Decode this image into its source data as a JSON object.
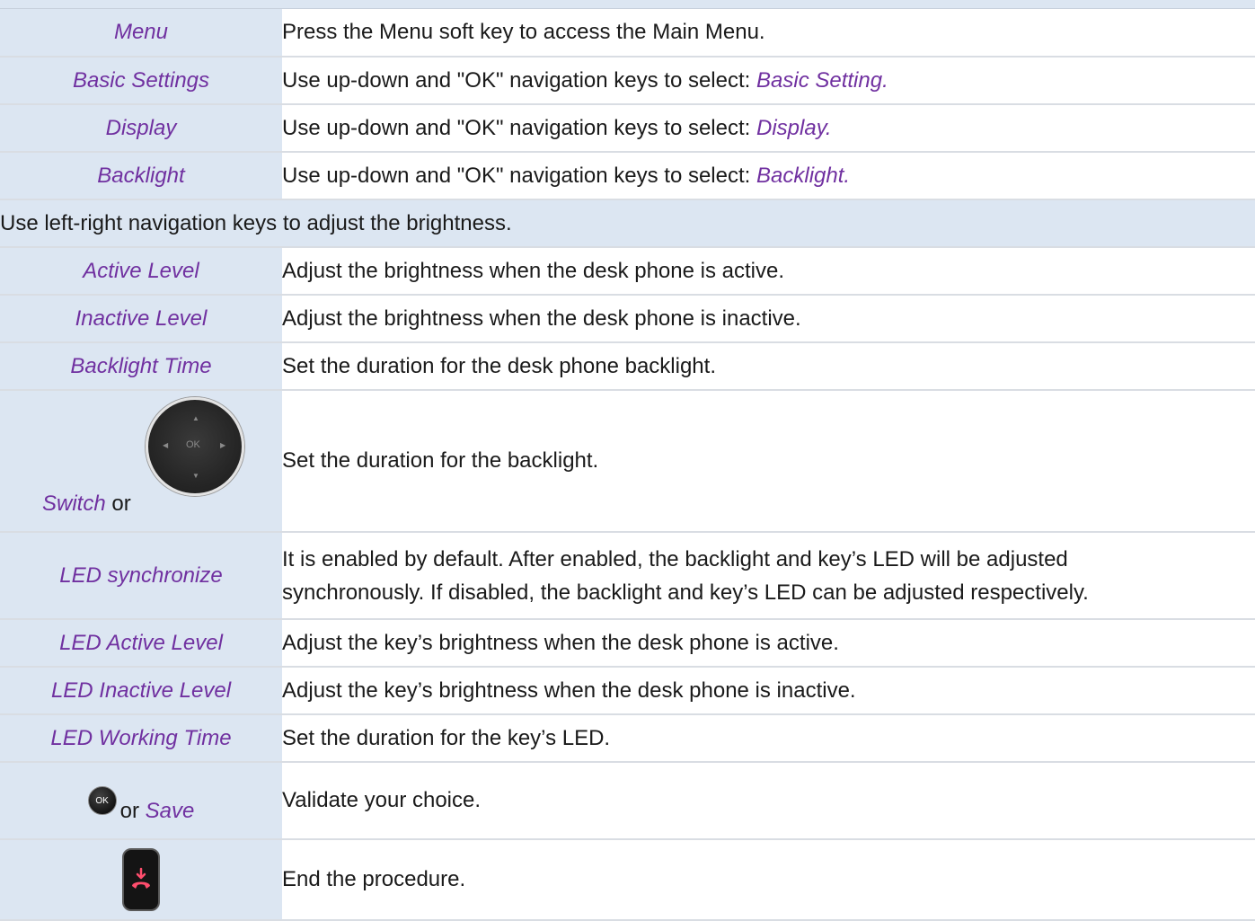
{
  "rows": [
    {
      "key": "Menu",
      "text": "Press the Menu soft key to access the Main Menu.",
      "hl": ""
    },
    {
      "key": "Basic Settings",
      "text": "Use up-down and \"OK\" navigation keys to select: ",
      "hl": "Basic Setting."
    },
    {
      "key": "Display",
      "text": "Use up-down and \"OK\" navigation keys to select: ",
      "hl": "Display."
    },
    {
      "key": "Backlight",
      "text": "Use up-down and \"OK\" navigation keys to select: ",
      "hl": "Backlight."
    }
  ],
  "section_note": "Use left-right navigation keys to adjust the brightness.",
  "levels": [
    {
      "key": "Active Level",
      "text": "Adjust the brightness when the desk phone is active."
    },
    {
      "key": "Inactive Level",
      "text": "Adjust the brightness when the desk phone is inactive."
    },
    {
      "key": "Backlight Time",
      "text": "Set the duration for the desk phone backlight."
    }
  ],
  "switch_row": {
    "key": "Switch",
    "or": "or",
    "text": "Set the duration for the backlight.",
    "pad": {
      "ok": "OK",
      "up": "▲",
      "down": "▼",
      "left": "◀",
      "right": "▶"
    }
  },
  "led_rows": [
    {
      "key": "LED synchronize",
      "line1": "It is enabled by default. After enabled, the backlight and key’s LED will be adjusted",
      "line2": "synchronously. If disabled, the backlight and key’s LED can be adjusted respectively."
    },
    {
      "key": "LED Active Level",
      "text": "Adjust the key’s brightness when the desk phone is active."
    },
    {
      "key": "LED Inactive Level",
      "text": "Adjust the key’s brightness when the desk phone is inactive."
    },
    {
      "key": "LED Working Time",
      "text": "Set the duration for the key’s LED."
    }
  ],
  "save_row": {
    "ok_label": "OK",
    "or": "or",
    "key": "Save",
    "text": "Validate your choice."
  },
  "end_row": {
    "icon": "end-call-key-icon",
    "text": "End the procedure."
  },
  "colors": {
    "header_bg": "#dce6f2",
    "accent": "#7030a0",
    "end_icon": "#ff4d6d"
  }
}
